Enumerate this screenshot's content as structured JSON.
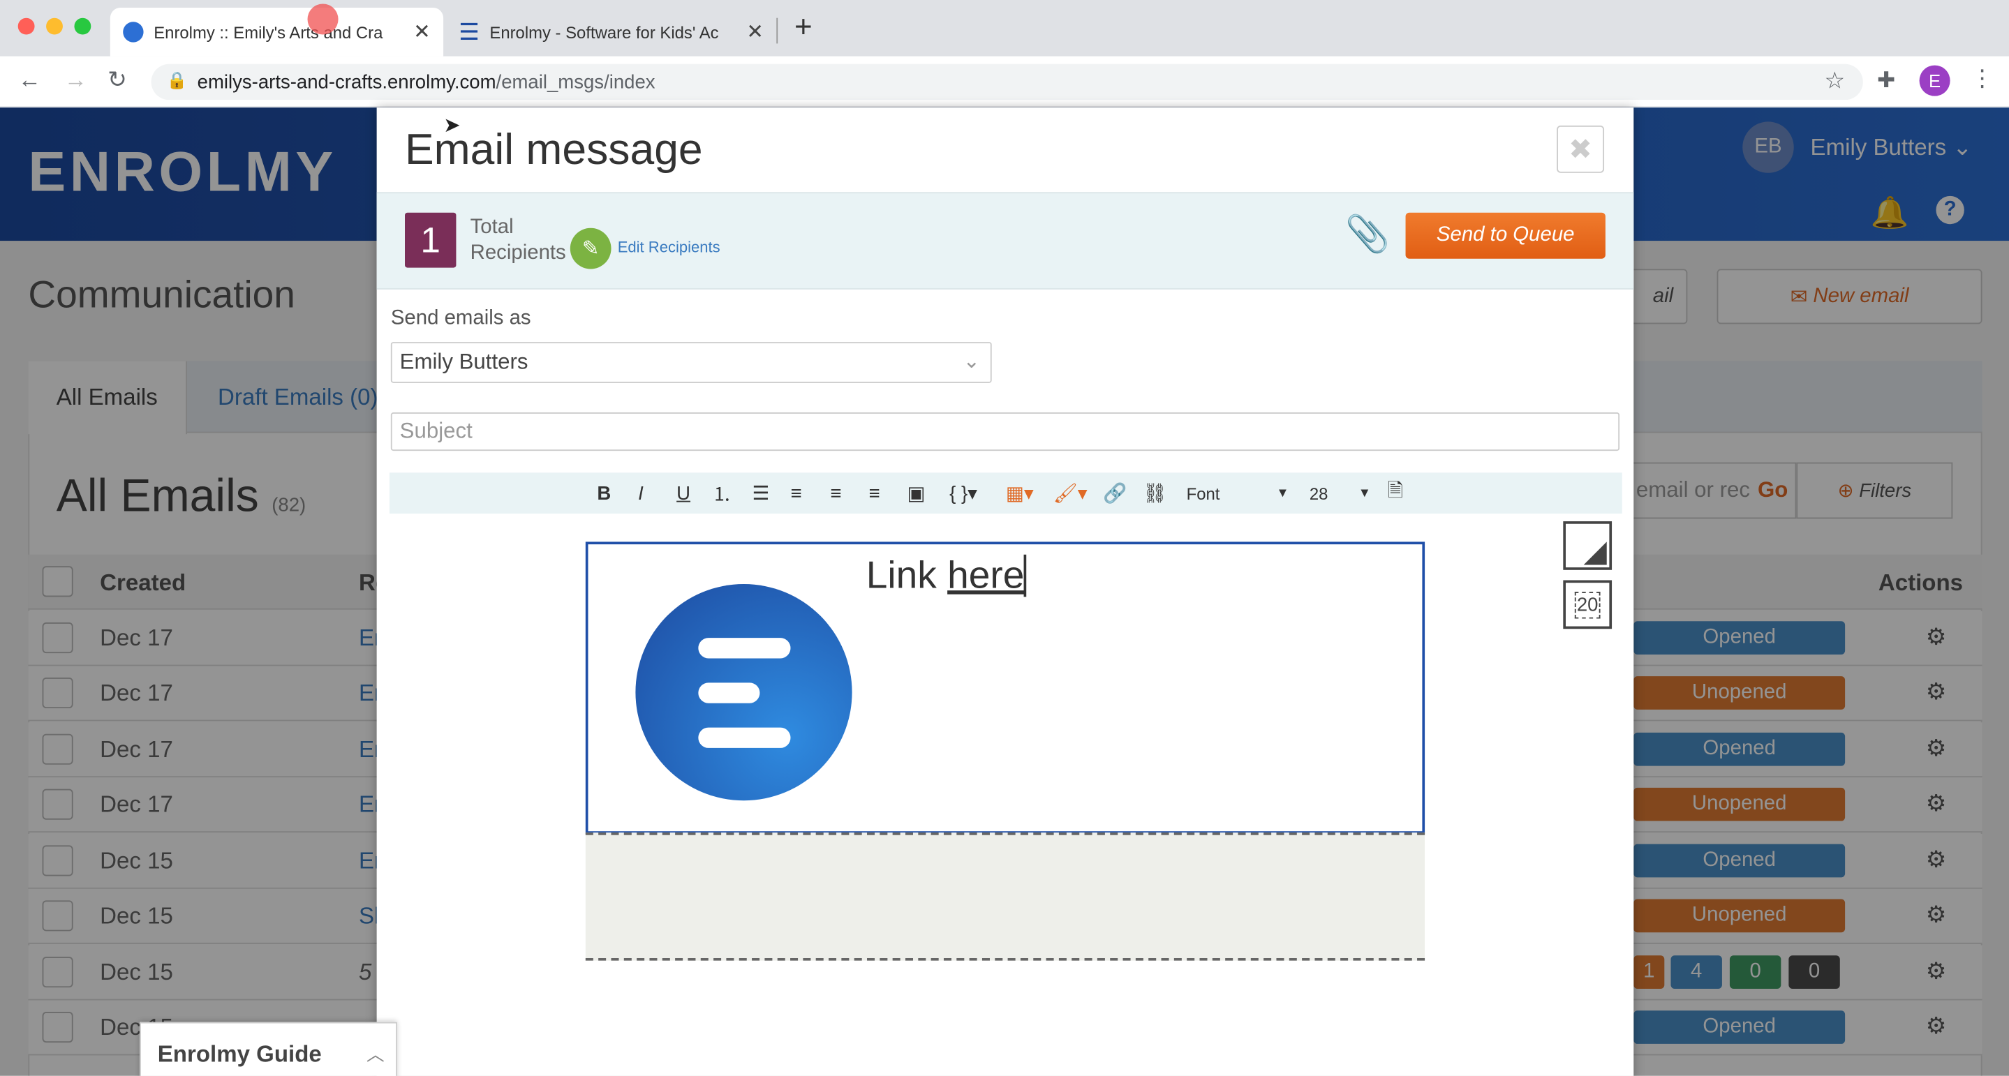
{
  "browser": {
    "tabs": [
      {
        "title": "Enrolmy :: Emily's Arts and Cra",
        "active": true
      },
      {
        "title": "Enrolmy - Software for Kids' Ac",
        "active": false
      }
    ],
    "new_tab": "+",
    "url_host": "emilys-arts-and-crafts.enrolmy.com",
    "url_path": "/email_msgs/index",
    "profile_initial": "E"
  },
  "app": {
    "logo": "ENROLMY",
    "user_initials": "EB",
    "user_name": "Emily Butters",
    "page_title": "Communication",
    "buttons": {
      "email_partial": "ail",
      "new_email": "New email"
    },
    "tabs": [
      "All Emails",
      "Draft Emails (0)"
    ],
    "list_title": "All Emails",
    "list_count": "(82)",
    "search_placeholder": "email or rec",
    "search_go": "Go",
    "filters": "Filters",
    "columns": {
      "created": "Created",
      "recipient": "Re",
      "actions": "Actions"
    },
    "rows": [
      {
        "date": "Dec 17",
        "recip": "En",
        "status": "Opened"
      },
      {
        "date": "Dec 17",
        "recip": "En",
        "status": "Unopened"
      },
      {
        "date": "Dec 17",
        "recip": "En",
        "status": "Opened"
      },
      {
        "date": "Dec 17",
        "recip": "En",
        "status": "Unopened"
      },
      {
        "date": "Dec 15",
        "recip": "En",
        "status": "Opened"
      },
      {
        "date": "Dec 15",
        "recip": "Sh",
        "status": "Unopened"
      },
      {
        "date": "Dec 15",
        "recip": "5",
        "status": ""
      },
      {
        "date": "Dec 15",
        "recip": "",
        "status": "Opened"
      }
    ],
    "stats_row": [
      "1",
      "4",
      "0",
      "0"
    ],
    "colors": {
      "opened": "#4a90c8",
      "unopened": "#e07a33",
      "stat_green": "#3e9a63",
      "stat_grey": "#4a4a4a"
    }
  },
  "modal": {
    "title": "Email message",
    "close": "✖",
    "recipient_count": "1",
    "total_label": "Total",
    "recipients_label": "Recipients",
    "edit_recipients": "Edit Recipients",
    "send_button": "Send to Queue",
    "send_as_label": "Send emails as",
    "send_as_value": "Emily Butters",
    "subject_placeholder": "Subject",
    "toolbar": {
      "font": "Font",
      "size": "28"
    },
    "editor_text": "Link ",
    "editor_link": "here",
    "size_badge": "20"
  },
  "guide": {
    "label": "Enrolmy Guide"
  }
}
